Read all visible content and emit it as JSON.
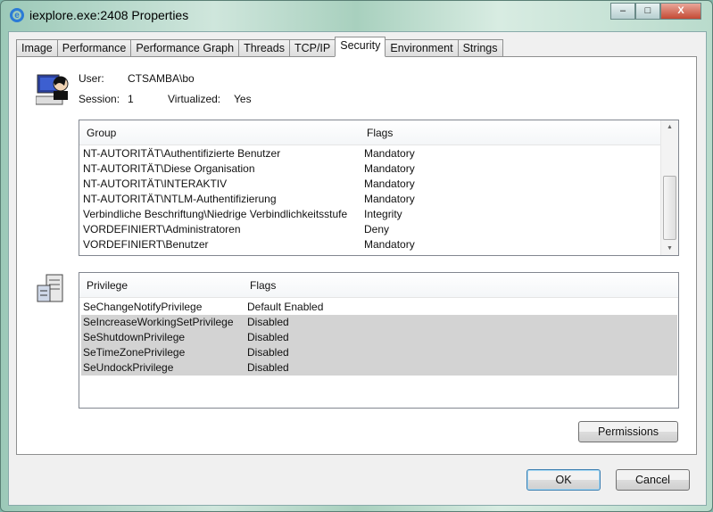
{
  "window": {
    "title": "iexplore.exe:2408 Properties",
    "minimize": "–",
    "maximize": "□",
    "close": "X"
  },
  "tabs": [
    "Image",
    "Performance",
    "Performance Graph",
    "Threads",
    "TCP/IP",
    "Security",
    "Environment",
    "Strings"
  ],
  "active_tab": "Security",
  "user_info": {
    "user_label": "User:",
    "user_value": "CTSAMBA\\bo",
    "session_label": "Session:",
    "session_value": "1",
    "virtualized_label": "Virtualized:",
    "virtualized_value": "Yes"
  },
  "groups": {
    "headers": [
      "Group",
      "Flags"
    ],
    "rows": [
      [
        "NT-AUTORITÄT\\Authentifizierte Benutzer",
        "Mandatory"
      ],
      [
        "NT-AUTORITÄT\\Diese Organisation",
        "Mandatory"
      ],
      [
        "NT-AUTORITÄT\\INTERAKTIV",
        "Mandatory"
      ],
      [
        "NT-AUTORITÄT\\NTLM-Authentifizierung",
        "Mandatory"
      ],
      [
        "Verbindliche Beschriftung\\Niedrige Verbindlichkeitsstufe",
        "Integrity"
      ],
      [
        "VORDEFINIERT\\Administratoren",
        "Deny"
      ],
      [
        "VORDEFINIERT\\Benutzer",
        "Mandatory"
      ]
    ]
  },
  "privileges": {
    "headers": [
      "Privilege",
      "Flags"
    ],
    "rows": [
      [
        "SeChangeNotifyPrivilege",
        "Default Enabled"
      ],
      [
        "SeIncreaseWorkingSetPrivilege",
        "Disabled"
      ],
      [
        "SeShutdownPrivilege",
        "Disabled"
      ],
      [
        "SeTimeZonePrivilege",
        "Disabled"
      ],
      [
        "SeUndockPrivilege",
        "Disabled"
      ]
    ]
  },
  "buttons": {
    "permissions": "Permissions",
    "ok": "OK",
    "cancel": "Cancel"
  }
}
